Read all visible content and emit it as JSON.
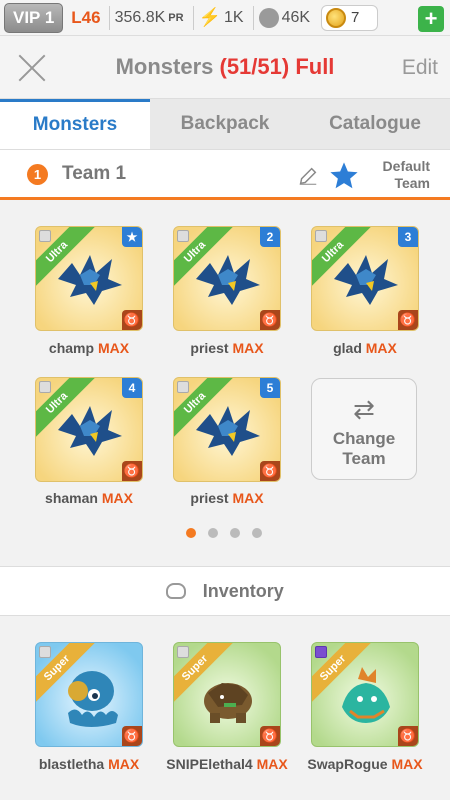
{
  "status": {
    "vip": "VIP 1",
    "level": "L46",
    "power": "356.8K",
    "power_unit": "PR",
    "energy": "1K",
    "food": "46K",
    "gold": "7"
  },
  "header": {
    "title": "Monsters",
    "count": "(51/51) Full",
    "edit": "Edit"
  },
  "tabs": [
    {
      "label": "Monsters",
      "active": true
    },
    {
      "label": "Backpack",
      "active": false
    },
    {
      "label": "Catalogue",
      "active": false
    }
  ],
  "team": {
    "number": "1",
    "name": "Team 1",
    "default_line1": "Default",
    "default_line2": "Team"
  },
  "team_monsters": [
    {
      "name": "champ",
      "level": "MAX",
      "rarity": "Ultra",
      "slot": "★"
    },
    {
      "name": "priest",
      "level": "MAX",
      "rarity": "Ultra",
      "slot": "2"
    },
    {
      "name": "glad",
      "level": "MAX",
      "rarity": "Ultra",
      "slot": "3"
    },
    {
      "name": "shaman",
      "level": "MAX",
      "rarity": "Ultra",
      "slot": "4"
    },
    {
      "name": "priest",
      "level": "MAX",
      "rarity": "Ultra",
      "slot": "5"
    }
  ],
  "change_team": {
    "line1": "Change",
    "line2": "Team"
  },
  "pagination": {
    "pages": 4,
    "current": 1
  },
  "inventory": {
    "label": "Inventory",
    "items": [
      {
        "name": "blastletha",
        "level": "MAX",
        "rarity": "Super"
      },
      {
        "name": "SNIPElethal4",
        "level": "MAX",
        "rarity": "Super"
      },
      {
        "name": "SwapRogue",
        "level": "MAX",
        "rarity": "Super",
        "tag": "R"
      }
    ]
  },
  "colors": {
    "accent": "#2a7bc8",
    "orange": "#f47a21",
    "full_red": "#e53935",
    "ultra_green": "#5db845",
    "super_gold": "#e8b13a"
  }
}
